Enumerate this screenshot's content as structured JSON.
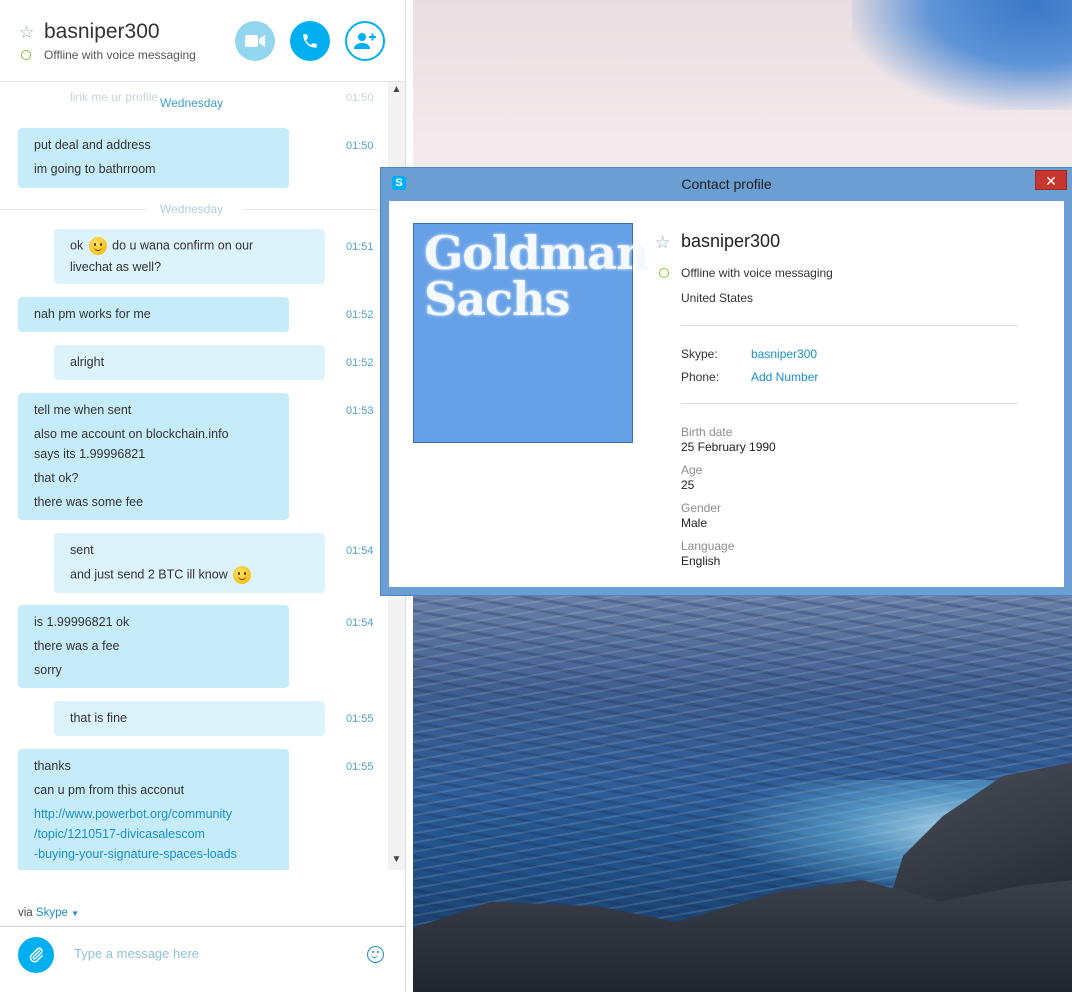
{
  "chat": {
    "contact_name": "basniper300",
    "status": "Offline with voice messaging",
    "buttons": {
      "video": "video-call",
      "call": "voice-call",
      "add": "add-people"
    },
    "ghost_message": "link me ur profile",
    "ghost_time": "01:50",
    "day_label": "Wednesday",
    "messages": [
      {
        "from": "them",
        "lines": [
          "put deal and address",
          "im going to bathrroom"
        ],
        "time": "01:50"
      },
      {
        "from": "me",
        "lines": [
          "ok",
          "do u wana confirm on our",
          "livechat as well?"
        ],
        "time": "01:51"
      },
      {
        "from": "them",
        "lines": [
          "nah pm works for me"
        ],
        "time": "01:52"
      },
      {
        "from": "me",
        "lines": [
          "alright"
        ],
        "time": "01:52"
      },
      {
        "from": "them",
        "lines": [
          "tell me when sent",
          "also me account on blockchain.info",
          "says its 1.99996821",
          "that ok?",
          "there was some fee"
        ],
        "time": "01:53"
      },
      {
        "from": "me",
        "lines": [
          "sent",
          "and just send 2 BTC ill know"
        ],
        "time": "01:54"
      },
      {
        "from": "them",
        "lines": [
          "is 1.99996821 ok",
          "there was a fee",
          "sorry"
        ],
        "time": "01:54"
      },
      {
        "from": "me",
        "lines": [
          "that is fine"
        ],
        "time": "01:55"
      },
      {
        "from": "them",
        "lines": [
          "thanks",
          "can u pm from this acconut",
          "http://www.powerbot.org/community",
          "/topic/1210517-divicasalescom",
          "-buying-your-signature-spaces-loads"
        ],
        "time": "01:55"
      }
    ],
    "via_prefix": "via",
    "via_service": "Skype",
    "compose_placeholder": "Type a message here"
  },
  "profile": {
    "window_title": "Contact profile",
    "avatar_text_line1": "Goldman",
    "avatar_text_line2": "Sachs",
    "name": "basniper300",
    "status": "Offline with voice messaging",
    "country": "United States",
    "skype_label": "Skype:",
    "skype_value": "basniper300",
    "phone_label": "Phone:",
    "phone_value": "Add Number",
    "birth_label": "Birth date",
    "birth_value": "25 February 1990",
    "age_label": "Age",
    "age_value": "25",
    "gender_label": "Gender",
    "gender_value": "Male",
    "language_label": "Language",
    "language_value": "English"
  },
  "colors": {
    "skype_blue": "#00aff0",
    "bubble_them": "#c7ecf9",
    "bubble_me": "#dcf3fb",
    "status_ring": "#8bbf2e",
    "close_red": "#c7372f",
    "avatar_blue": "#66a1e7"
  }
}
